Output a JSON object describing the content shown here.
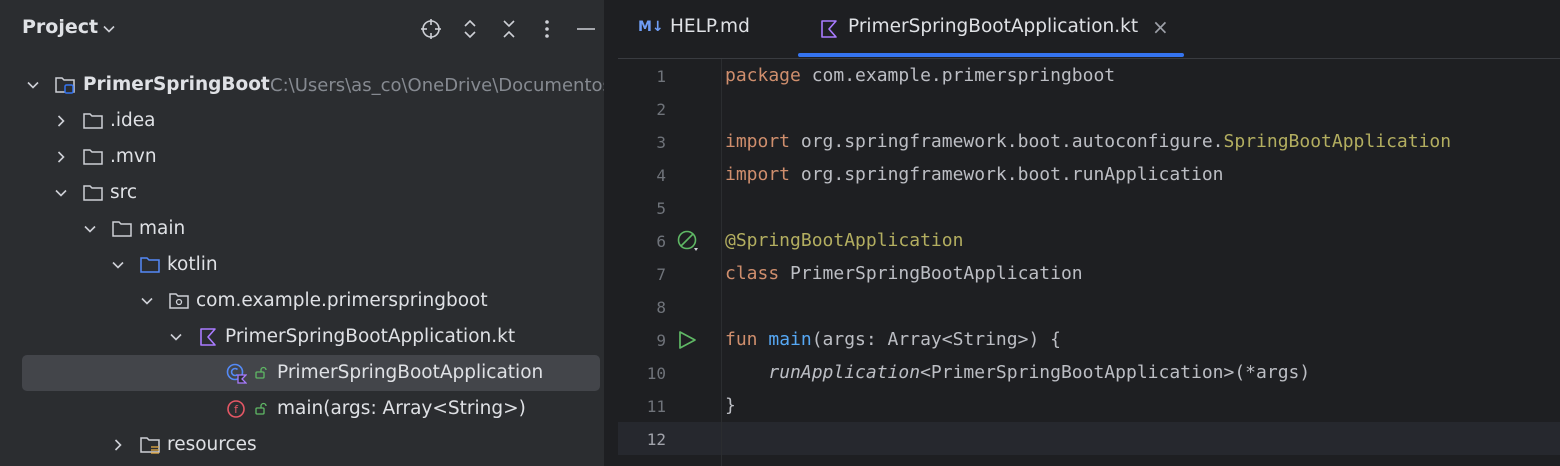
{
  "project_panel": {
    "title": "Project",
    "tree": [
      {
        "label": "PrimerSpringBoot",
        "path": "C:\\Users\\as_co\\OneDrive\\Documentos",
        "icon": "project-folder-icon",
        "expanded": true
      },
      {
        "label": ".idea",
        "icon": "folder-icon",
        "expanded": false
      },
      {
        "label": ".mvn",
        "icon": "folder-icon",
        "expanded": false
      },
      {
        "label": "src",
        "icon": "folder-icon",
        "expanded": true
      },
      {
        "label": "main",
        "icon": "folder-icon",
        "expanded": true
      },
      {
        "label": "kotlin",
        "icon": "source-root-folder-icon",
        "expanded": true
      },
      {
        "label": "com.example.primerspringboot",
        "icon": "package-icon",
        "expanded": true
      },
      {
        "label": "PrimerSpringBootApplication.kt",
        "icon": "kotlin-file-icon",
        "expanded": true
      },
      {
        "label": "PrimerSpringBootApplication",
        "icon": "kotlin-class-icon",
        "selected": true
      },
      {
        "label": "main(args: Array<String>)",
        "icon": "function-icon"
      },
      {
        "label": "resources",
        "icon": "resources-folder-icon",
        "expanded": false
      }
    ]
  },
  "editor": {
    "tabs": [
      {
        "label": "HELP.md",
        "badge": "M↓",
        "active": false
      },
      {
        "label": "PrimerSpringBootApplication.kt",
        "active": true,
        "close": "×"
      }
    ],
    "line_numbers": [
      "1",
      "2",
      "3",
      "4",
      "5",
      "6",
      "7",
      "8",
      "9",
      "10",
      "11",
      "12"
    ],
    "current_line": "12",
    "code": {
      "l1_kw": "package",
      "l1_rest": " com.example.primerspringboot",
      "l3_kw": "import",
      "l3_rest": " org.springframework.boot.autoconfigure.",
      "l3_ann": "SpringBootApplication",
      "l4_kw": "import",
      "l4_rest": " org.springframework.boot.runApplication",
      "l6_ann": "@SpringBootApplication",
      "l7_kw": "class",
      "l7_rest": " PrimerSpringBootApplication",
      "l9_kw": "fun",
      "l9_fn": " main",
      "l9_rest": "(args: Array<String>) {",
      "l10_indent": "    ",
      "l10_it": "runApplication",
      "l10_rest": "<PrimerSpringBootApplication>(*args)",
      "l11": "}"
    }
  },
  "colors": {
    "keyword": "#cf8e6d",
    "annotation": "#b3ae60",
    "function": "#56a8f5",
    "accent": "#3574f0"
  }
}
